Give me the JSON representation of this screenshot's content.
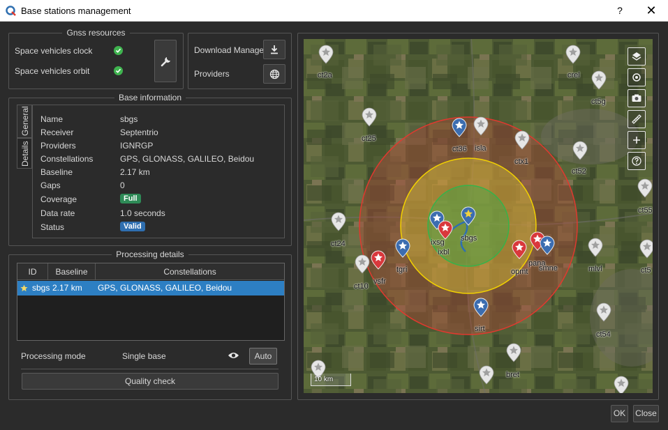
{
  "window": {
    "title": "Base stations management",
    "help": "?",
    "close": "✕"
  },
  "gnss": {
    "title": "Gnss resources",
    "items": [
      {
        "label": "Space vehicles clock",
        "status": "ok"
      },
      {
        "label": "Space vehicles orbit",
        "status": "ok"
      }
    ],
    "settings_icon": "wrench-icon"
  },
  "tools": {
    "download_manager": "Download Manager",
    "providers": "Providers"
  },
  "base_info": {
    "title": "Base information",
    "tabs": [
      "General",
      "Details"
    ],
    "active_tab": "Details",
    "fields": [
      {
        "key": "Name",
        "value": "sbgs"
      },
      {
        "key": "Receiver",
        "value": "Septentrio"
      },
      {
        "key": "Providers",
        "value": "IGNRGP"
      },
      {
        "key": "Constellations",
        "value": "GPS, GLONASS, GALILEO, Beidou"
      },
      {
        "key": "Baseline",
        "value": "2.17 km"
      },
      {
        "key": "Gaps",
        "value": "0"
      }
    ],
    "coverage": {
      "key": "Coverage",
      "value": "Full",
      "color": "#2e8b57"
    },
    "data_rate": {
      "key": "Data rate",
      "value": "1.0 seconds"
    },
    "status": {
      "key": "Status",
      "value": "Valid",
      "color": "#2f6fb0"
    }
  },
  "processing": {
    "title": "Processing details",
    "columns": [
      "ID",
      "Baseline",
      "Constellations"
    ],
    "rows": [
      {
        "starred": true,
        "id": "sbgs",
        "baseline": "2.17 km",
        "constellations": "GPS, GLONASS, GALILEO, Beidou"
      }
    ],
    "mode_label": "Processing mode",
    "mode_value": "Single base",
    "auto_label": "Auto",
    "quality_check": "Quality check"
  },
  "map": {
    "scale": "10 km",
    "rings": [
      {
        "name": "outer",
        "color": "#e0392f"
      },
      {
        "name": "middle",
        "color": "#f2d100"
      },
      {
        "name": "inner",
        "color": "#35b34a"
      }
    ],
    "stations": [
      {
        "label": "ct2a",
        "color": "grey"
      },
      {
        "label": "crel",
        "color": "grey"
      },
      {
        "label": "ct5g",
        "color": "grey"
      },
      {
        "label": "ct25",
        "color": "grey"
      },
      {
        "label": "ct36",
        "color": "blue"
      },
      {
        "label": "isla",
        "color": "grey"
      },
      {
        "label": "ctx1",
        "color": "grey"
      },
      {
        "label": "ct52",
        "color": "grey"
      },
      {
        "label": "ct55",
        "color": "grey"
      },
      {
        "label": "ct24",
        "color": "grey"
      },
      {
        "label": "ixsg",
        "color": "blue"
      },
      {
        "label": "ixbl",
        "color": "red"
      },
      {
        "label": "sbgs",
        "color": "blue"
      },
      {
        "label": "pana",
        "color": "red"
      },
      {
        "label": "smne",
        "color": "blue"
      },
      {
        "label": "opmt",
        "color": "red"
      },
      {
        "label": "mlvl",
        "color": "grey"
      },
      {
        "label": "ct5",
        "color": "grey"
      },
      {
        "label": "tgri",
        "color": "blue"
      },
      {
        "label": "vsfr",
        "color": "red"
      },
      {
        "label": "ct10",
        "color": "grey"
      },
      {
        "label": "sirt",
        "color": "blue"
      },
      {
        "label": "ct54",
        "color": "grey"
      },
      {
        "label": "bret",
        "color": "grey"
      }
    ],
    "tools": [
      "layers-icon",
      "locate-icon",
      "camera-icon",
      "ruler-icon",
      "zoom-in-icon",
      "help-icon"
    ]
  },
  "footer": {
    "ok": "OK",
    "close": "Close"
  }
}
